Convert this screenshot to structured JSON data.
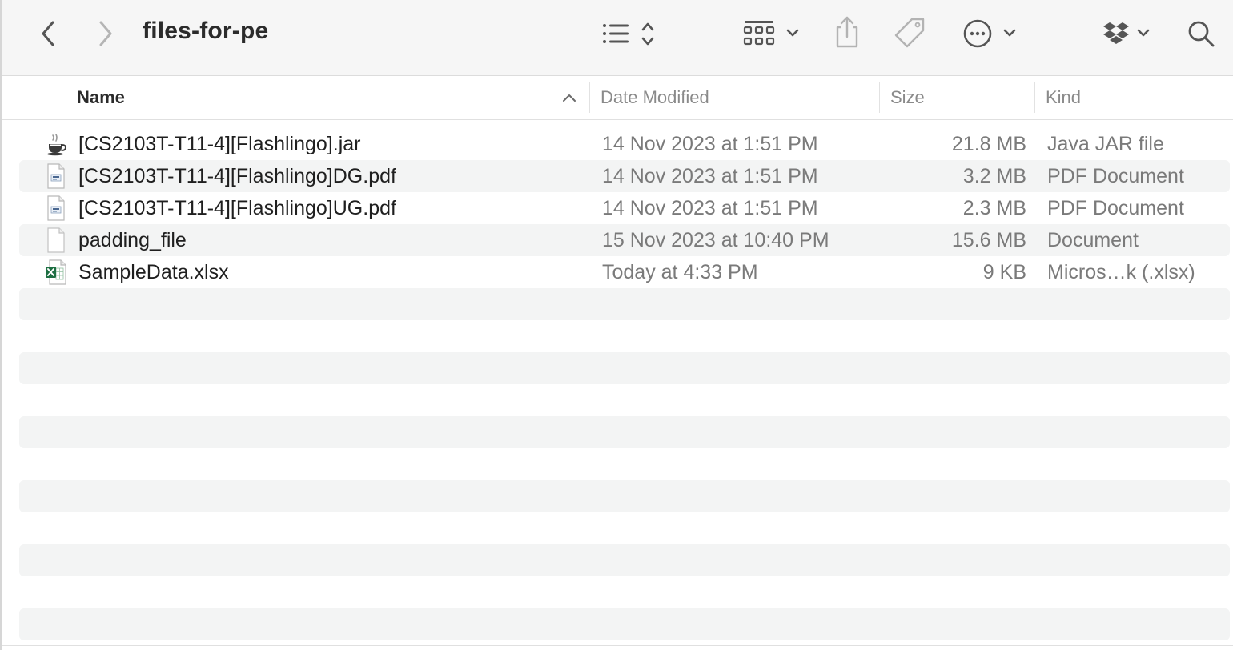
{
  "window": {
    "title": "files-for-pe"
  },
  "toolbar": {
    "back_icon": "chevron-left-icon",
    "forward_icon": "chevron-right-icon",
    "view_list_icon": "list-view-icon",
    "group_icon": "grid-group-icon",
    "share_icon": "share-icon",
    "tag_icon": "tag-icon",
    "more_icon": "ellipsis-circle-icon",
    "dropbox_icon": "dropbox-icon",
    "search_icon": "search-icon"
  },
  "columns": {
    "name": "Name",
    "date": "Date Modified",
    "size": "Size",
    "kind": "Kind"
  },
  "files": [
    {
      "icon": "jar-icon",
      "name": "[CS2103T-T11-4][Flashlingo].jar",
      "date": "14 Nov 2023 at 1:51 PM",
      "size": "21.8 MB",
      "kind": "Java JAR file"
    },
    {
      "icon": "pdf-icon",
      "name": "[CS2103T-T11-4][Flashlingo]DG.pdf",
      "date": "14 Nov 2023 at 1:51 PM",
      "size": "3.2 MB",
      "kind": "PDF Document"
    },
    {
      "icon": "pdf-icon",
      "name": "[CS2103T-T11-4][Flashlingo]UG.pdf",
      "date": "14 Nov 2023 at 1:51 PM",
      "size": "2.3 MB",
      "kind": "PDF Document"
    },
    {
      "icon": "document-icon",
      "name": "padding_file",
      "date": "15 Nov 2023 at 10:40 PM",
      "size": "15.6 MB",
      "kind": "Document"
    },
    {
      "icon": "excel-icon",
      "name": "SampleData.xlsx",
      "date": "Today at 4:33 PM",
      "size": "9 KB",
      "kind": "Micros…k (.xlsx)"
    }
  ],
  "colors": {
    "toolbar_bg": "#f6f6f6",
    "stripe": "#f3f4f4",
    "secondary_text": "#7a7a7a",
    "primary_text": "#1f1f1f",
    "excel_green": "#1d6f42"
  }
}
